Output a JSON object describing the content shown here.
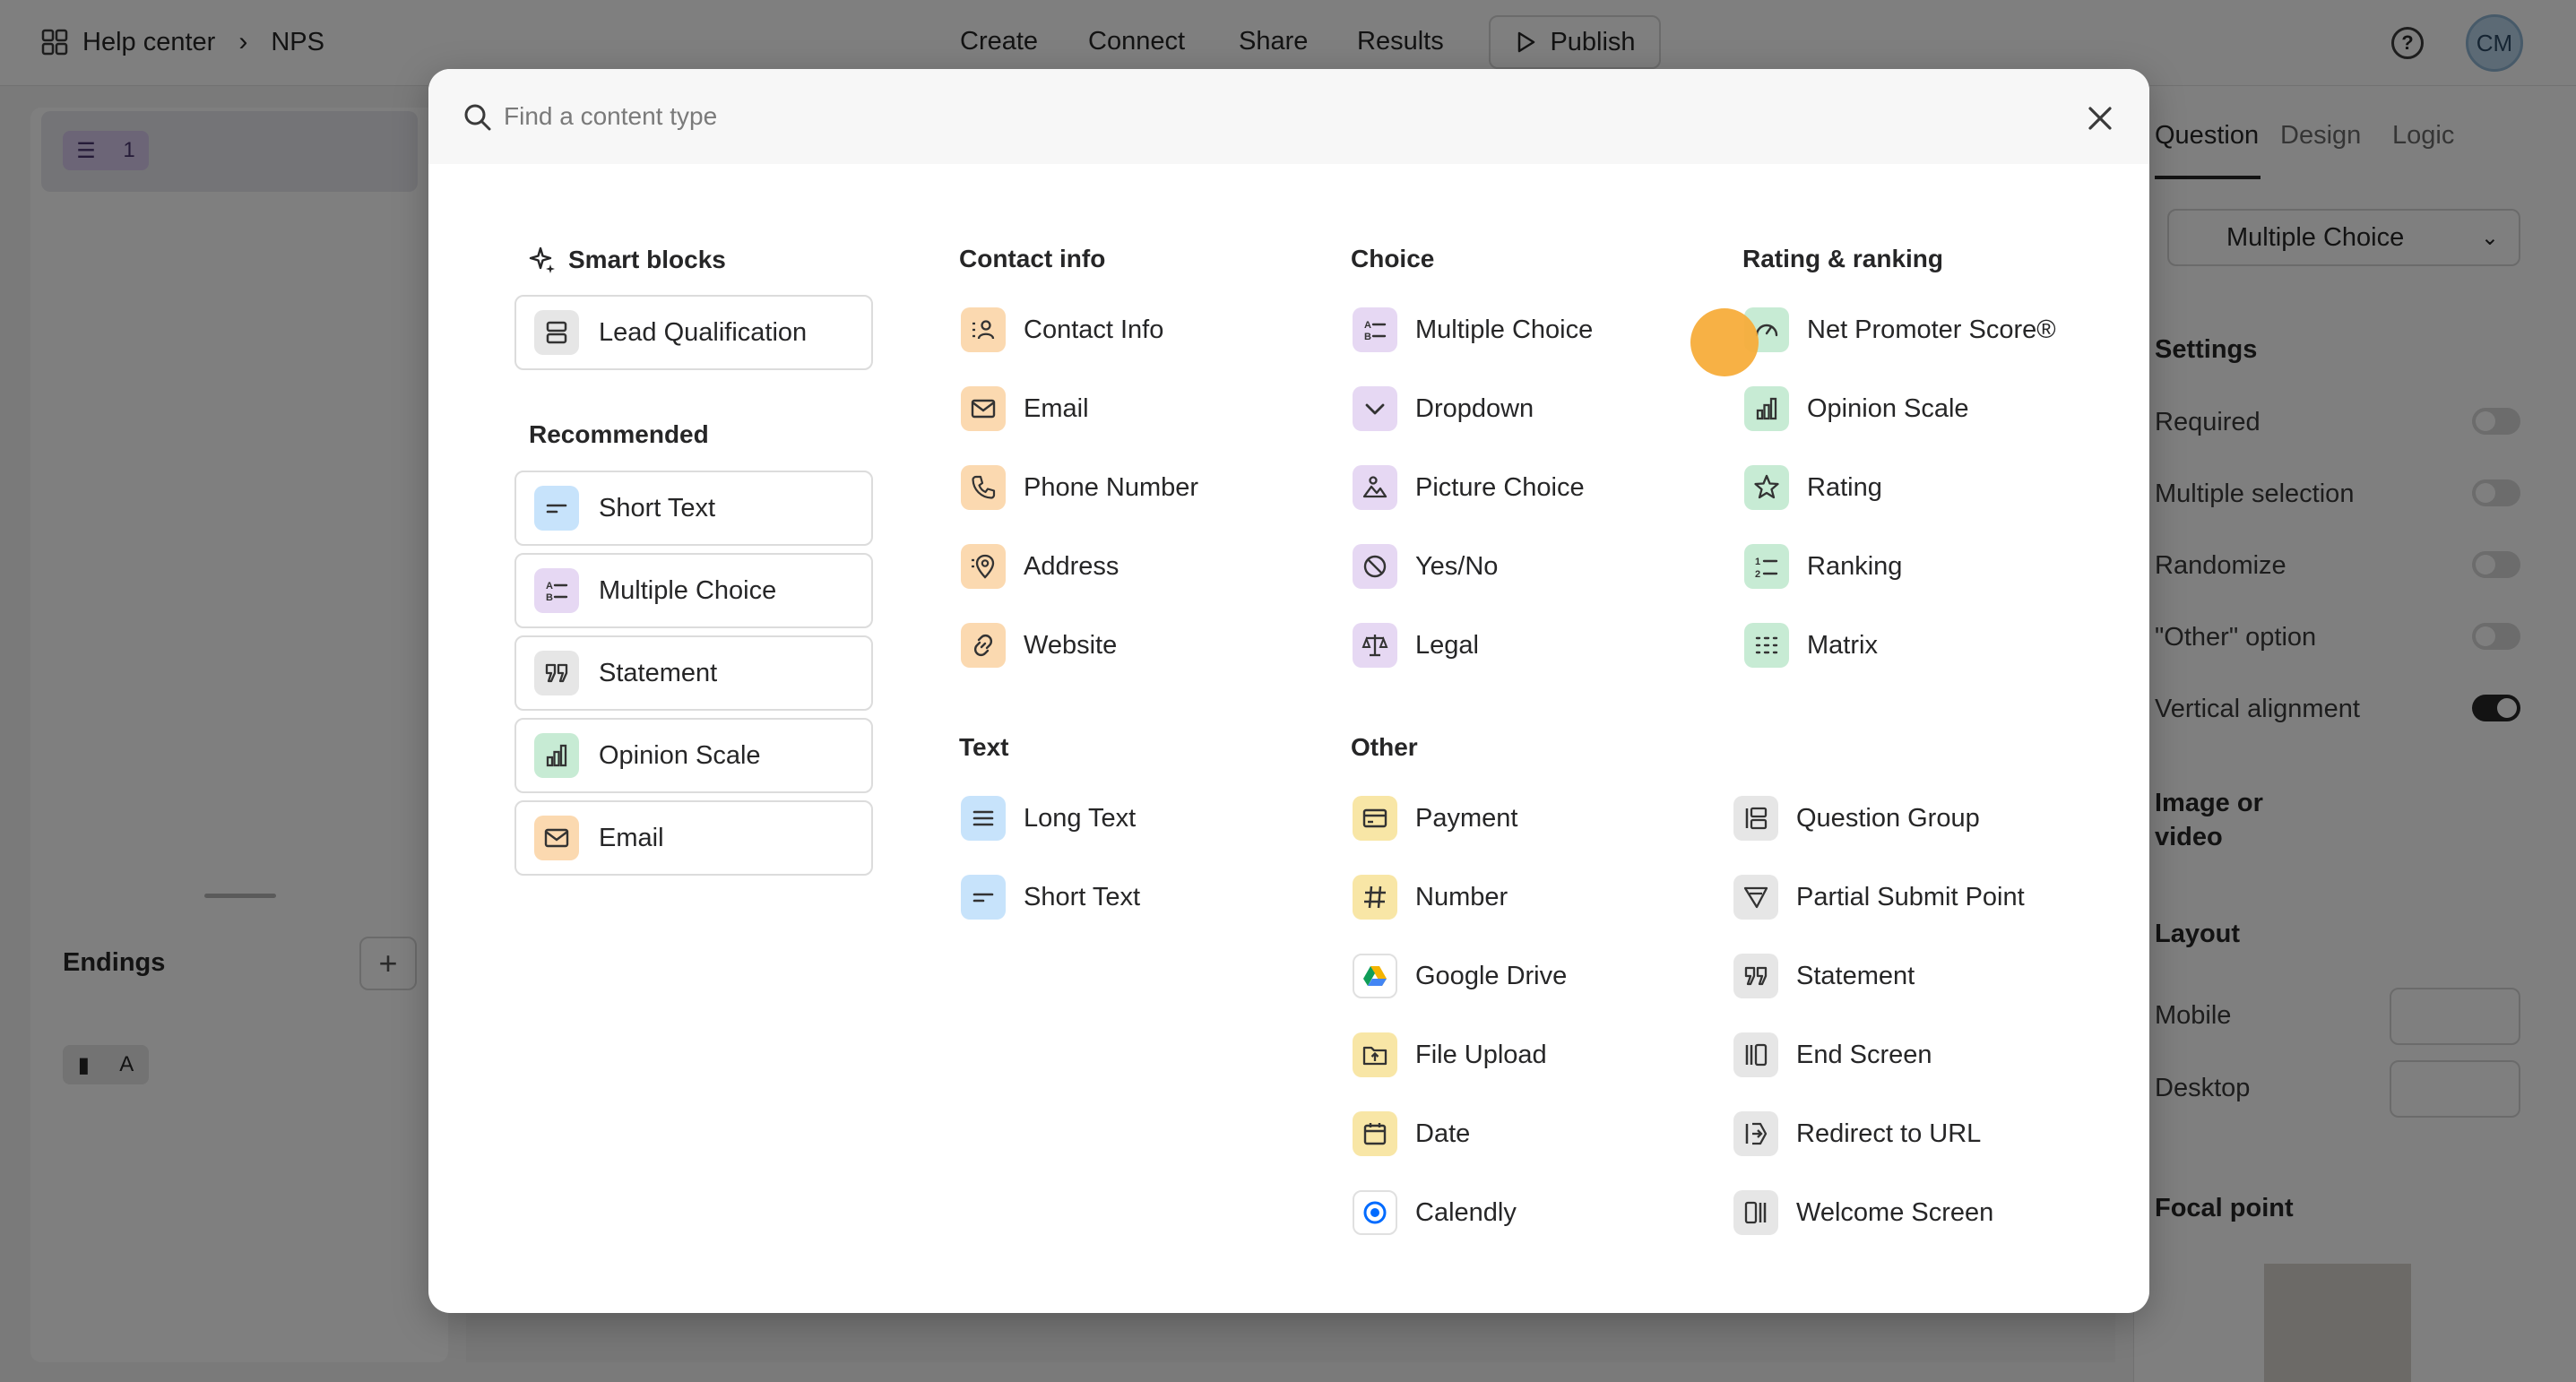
{
  "topbar": {
    "breadcrumb": [
      "Help center",
      "NPS"
    ],
    "nav": [
      "Create",
      "Connect",
      "Share",
      "Results"
    ],
    "publish_label": "Publish",
    "avatar": "CM"
  },
  "left": {
    "question_number": "1",
    "endings_label": "Endings",
    "ending_letter": "A"
  },
  "right": {
    "tabs": [
      "Question",
      "Design",
      "Logic"
    ],
    "type_value": "Multiple Choice",
    "settings_title": "Settings",
    "settings": [
      {
        "label": "Required",
        "on": false
      },
      {
        "label": "Multiple selection",
        "on": false
      },
      {
        "label": "Randomize",
        "on": false
      },
      {
        "label": "\"Other\" option",
        "on": false
      },
      {
        "label": "Vertical alignment",
        "on": true
      }
    ],
    "image_label_1": "Image or",
    "image_label_2": "video",
    "layout_title": "Layout",
    "mobile_label": "Mobile",
    "desktop_label": "Desktop",
    "focal_title": "Focal point"
  },
  "modal": {
    "search_placeholder": "Find a content type",
    "smart_blocks": {
      "title": "Smart blocks",
      "items": [
        "Lead Qualification"
      ]
    },
    "recommended": {
      "title": "Recommended",
      "items": [
        "Short Text",
        "Multiple Choice",
        "Statement",
        "Opinion Scale",
        "Email"
      ]
    },
    "contact_info": {
      "title": "Contact info",
      "items": [
        "Contact Info",
        "Email",
        "Phone Number",
        "Address",
        "Website"
      ]
    },
    "text": {
      "title": "Text",
      "items": [
        "Long Text",
        "Short Text"
      ]
    },
    "choice": {
      "title": "Choice",
      "items": [
        "Multiple Choice",
        "Dropdown",
        "Picture Choice",
        "Yes/No",
        "Legal"
      ]
    },
    "other": {
      "title": "Other",
      "items": [
        "Payment",
        "Number",
        "Google Drive",
        "File Upload",
        "Date",
        "Calendly"
      ]
    },
    "rating": {
      "title": "Rating & ranking",
      "items": [
        "Net Promoter Score®",
        "Opinion Scale",
        "Rating",
        "Ranking",
        "Matrix"
      ]
    },
    "misc": {
      "items": [
        "Question Group",
        "Partial Submit Point",
        "Statement",
        "End Screen",
        "Redirect to URL",
        "Welcome Screen"
      ]
    }
  }
}
